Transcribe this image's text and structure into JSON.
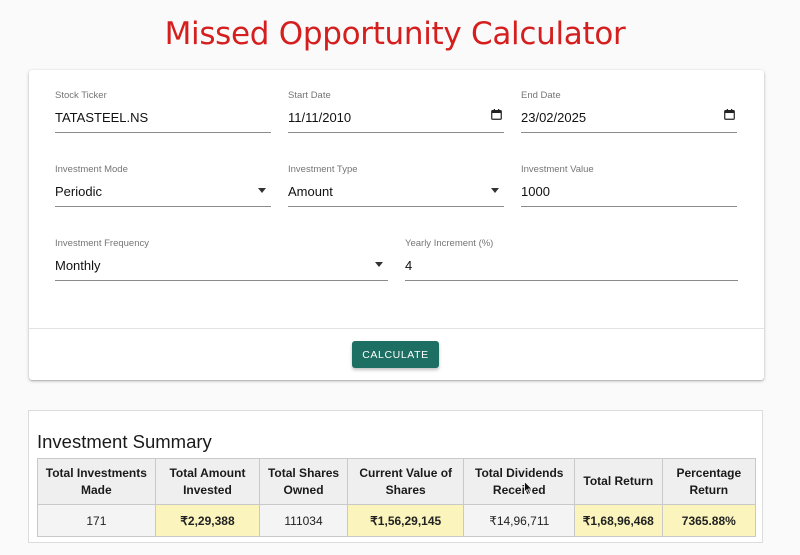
{
  "page": {
    "title": "Missed Opportunity Calculator"
  },
  "form": {
    "stock_ticker": {
      "label": "Stock Ticker",
      "value": "TATASTEEL.NS"
    },
    "start_date": {
      "label": "Start Date",
      "value": "11/11/2010"
    },
    "end_date": {
      "label": "End Date",
      "value": "23/02/2025"
    },
    "investment_mode": {
      "label": "Investment Mode",
      "value": "Periodic"
    },
    "investment_type": {
      "label": "Investment Type",
      "value": "Amount"
    },
    "investment_value": {
      "label": "Investment Value",
      "value": "1000"
    },
    "investment_frequency": {
      "label": "Investment Frequency",
      "value": "Monthly"
    },
    "yearly_increment": {
      "label": "Yearly Increment (%)",
      "value": "4"
    },
    "calculate_label": "CALCULATE"
  },
  "summary": {
    "heading": "Investment Summary",
    "columns": [
      "Total Investments Made",
      "Total Amount Invested",
      "Total Shares Owned",
      "Current Value of Shares",
      "Total Dividends Received",
      "Total Return",
      "Percentage Return"
    ],
    "values": [
      "171",
      "₹2,29,388",
      "111034",
      "₹1,56,29,145",
      "₹14,96,711",
      "₹1,68,96,468",
      "7365.88%"
    ],
    "highlight_color": "#fbf5bd"
  },
  "icons": {
    "dropdown": "chevron-down-icon",
    "calendar": "calendar-icon",
    "cursor": "mouse-cursor-icon"
  }
}
